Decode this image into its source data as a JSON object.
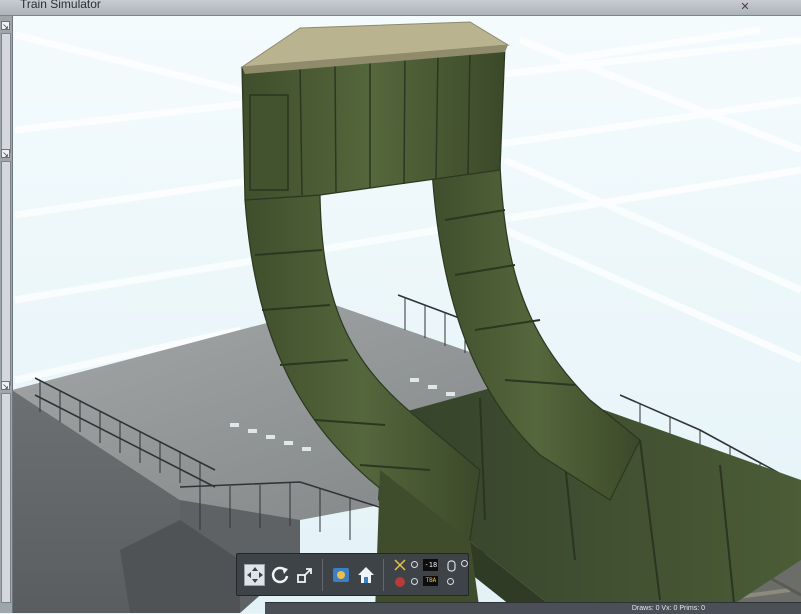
{
  "window": {
    "title": "Train Simulator",
    "close_glyph": "✕"
  },
  "left_panel": {
    "pins": [
      "pin-icon",
      "pin-icon",
      "pin-icon"
    ]
  },
  "toolbar": {
    "tools": [
      "select-icon",
      "rotate-icon",
      "scale-icon",
      "camera-icon",
      "home-icon"
    ],
    "readout_top": "-18",
    "readout_bottom": "TBA"
  },
  "status": {
    "text": "Draws: 0  Vx: 0  Prims: 0"
  },
  "colors": {
    "sky": "#eaf6fa",
    "steel_green": "#4c5d36",
    "concrete": "#8c8f90",
    "roof": "#b9b38f"
  }
}
